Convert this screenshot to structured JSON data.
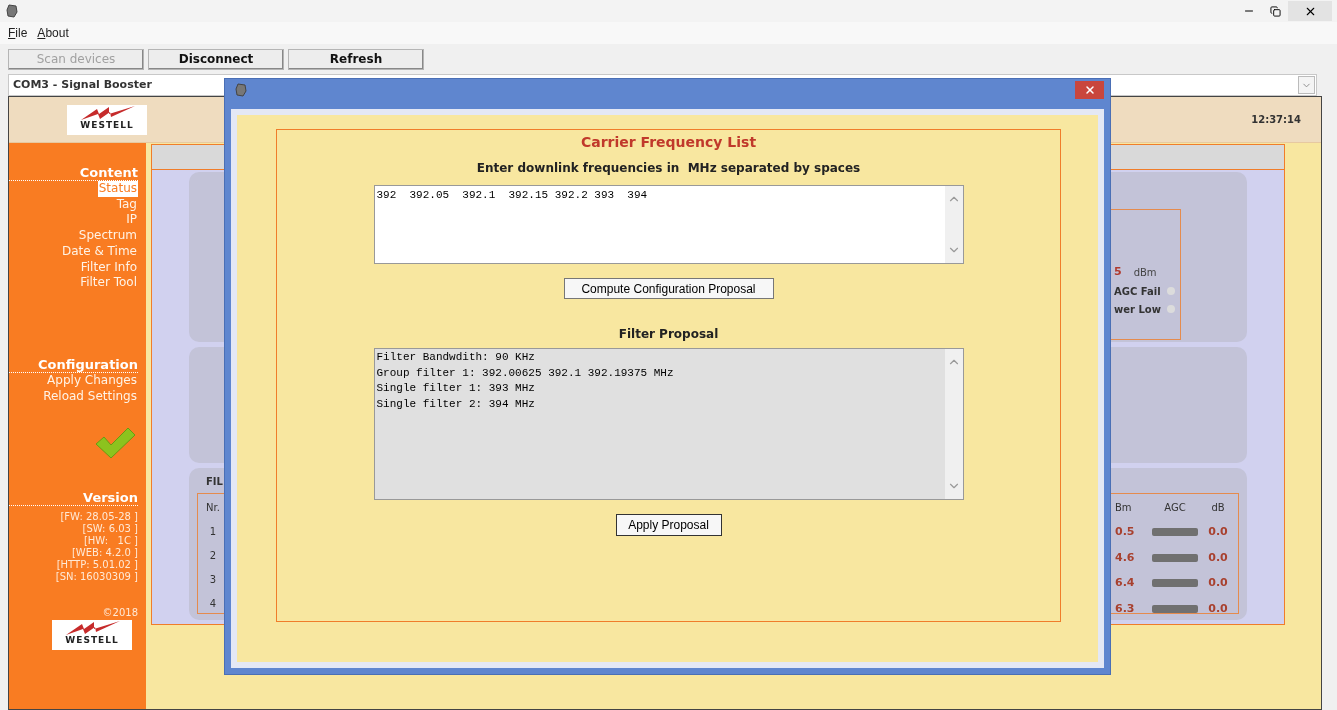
{
  "menu": [
    {
      "label": "File"
    },
    {
      "label": "About"
    }
  ],
  "toolbar": [
    {
      "label": "Scan devices",
      "disabled": true
    },
    {
      "label": "Disconnect",
      "disabled": false
    },
    {
      "label": "Refresh",
      "disabled": false
    }
  ],
  "device_select": {
    "value": "COM3 - Signal Booster"
  },
  "header": {
    "logo_text": "WESTELL",
    "time": "12:37:14"
  },
  "sidebar": {
    "sections": [
      {
        "title": "Content",
        "items": [
          {
            "label": "Status",
            "selected": true
          },
          {
            "label": "Tag",
            "selected": false
          },
          {
            "label": "IP",
            "selected": false
          },
          {
            "label": "Spectrum",
            "selected": false
          },
          {
            "label": "Date & Time",
            "selected": false
          },
          {
            "label": "Filter Info",
            "selected": false
          },
          {
            "label": "Filter Tool",
            "selected": false
          }
        ]
      },
      {
        "title": "Configuration",
        "items": [
          {
            "label": "Apply Changes",
            "selected": false
          },
          {
            "label": "Reload Settings",
            "selected": false
          }
        ]
      }
    ],
    "version": {
      "title": "Version",
      "lines": [
        "[FW: 28.05-28 ]",
        "[SW: 6.03 ]",
        "[HW:   1C ]",
        "[WEB: 4.2.0 ]",
        "[HTTP: 5.01.02 ]",
        "[SN: 16030309 ]"
      ]
    },
    "copyright": "©2018",
    "logo_text": "WESTELL"
  },
  "status_panel": {
    "value": "5",
    "unit": "dBm",
    "alarms": [
      {
        "label": "AGC Fail",
        "on": false
      },
      {
        "label": "wer Low",
        "on": false
      }
    ]
  },
  "filter_table": {
    "title": "FIL",
    "columns": [
      "Nr.",
      "Bm",
      "AGC",
      "dB"
    ],
    "rows": [
      {
        "nr": "1",
        "dbm": "0.5",
        "db": "0.0"
      },
      {
        "nr": "2",
        "dbm": "4.6",
        "db": "0.0"
      },
      {
        "nr": "3",
        "dbm": "6.4",
        "db": "0.0"
      },
      {
        "nr": "4",
        "dbm": "6.3",
        "db": "0.0"
      }
    ]
  },
  "dialog": {
    "title": "Carrier Frequency List",
    "prompt": "Enter downlink frequencies in  MHz separated by spaces",
    "frequencies": "392  392.05  392.1  392.15 392.2 393  394",
    "compute_button": "Compute Configuration Proposal",
    "proposal_title": "Filter Proposal",
    "proposal_lines": [
      "Filter Bandwdith: 90 KHz",
      "Group filter 1: 392.00625 392.1 392.19375 MHz",
      "Single filter 1: 393 MHz",
      "Single filter 2: 394 MHz"
    ],
    "apply_button": "Apply Proposal"
  }
}
